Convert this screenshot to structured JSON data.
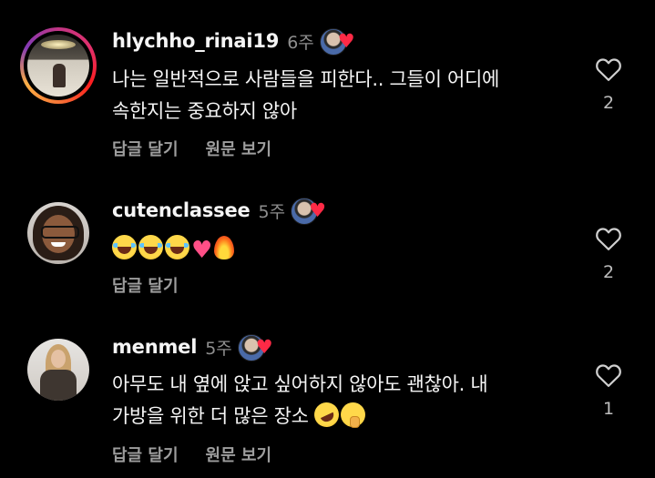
{
  "comments": [
    {
      "username": "hlychho_rinai19",
      "time": "6주",
      "text_lines": [
        "나는 일반적으로 사람들을 피한다.. 그들이 어디에",
        "속한지는 중요하지 않아"
      ],
      "actions": [
        "답글 달기",
        "원문 보기"
      ],
      "like_count": "2",
      "avatar": "interior-room-photo",
      "has_story_ring": true
    },
    {
      "username": "cutenclassee",
      "time": "5주",
      "emojis": [
        "face-with-tears-of-joy",
        "face-with-tears-of-joy",
        "face-with-tears-of-joy",
        "pink-heart",
        "fire"
      ],
      "actions": [
        "답글 달기"
      ],
      "like_count": "2",
      "avatar": "woman-with-glasses-photo"
    },
    {
      "username": "menmel",
      "time": "5주",
      "text_lines": [
        "아무도 내 옆에 앉고 싶어하지 않아도 괜찮아. 내",
        "가방을 위한 더 많은 장소"
      ],
      "trailing_emojis": [
        "rolling-on-the-floor-laughing",
        "face-with-hand-over-mouth"
      ],
      "actions": [
        "답글 달기",
        "원문 보기"
      ],
      "like_count": "1",
      "avatar": "woman-in-coat-photo"
    }
  ],
  "badge": {
    "icon": "creator-liked-heart-icon",
    "heart_color": "#ff2a46"
  },
  "colors": {
    "background": "#000000",
    "primary_text": "#f5f5f5",
    "secondary_text": "#8e8e8e"
  }
}
